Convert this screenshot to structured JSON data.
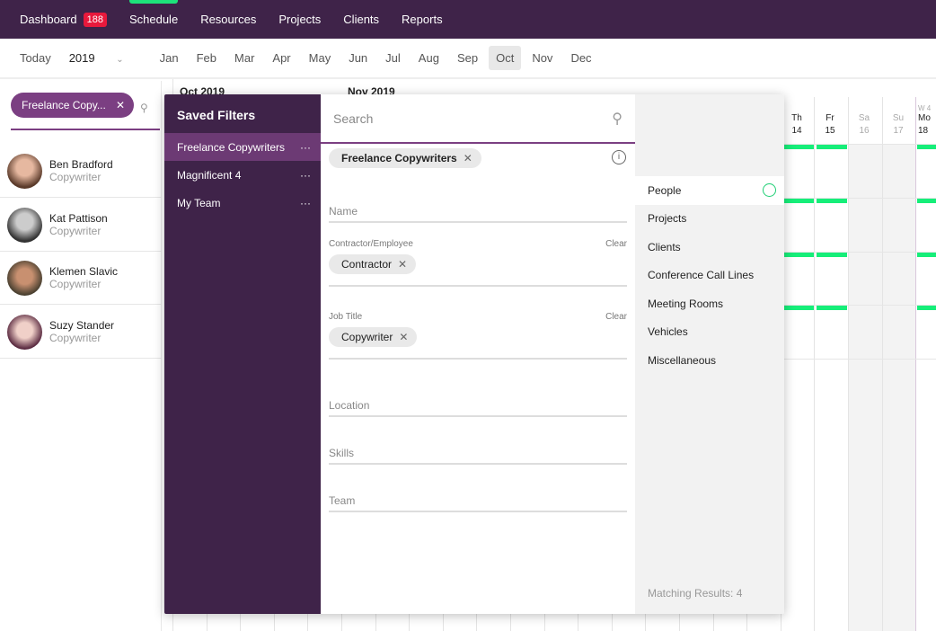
{
  "nav": {
    "items": [
      {
        "label": "Dashboard",
        "badge": "188"
      },
      {
        "label": "Schedule"
      },
      {
        "label": "Resources"
      },
      {
        "label": "Projects"
      },
      {
        "label": "Clients"
      },
      {
        "label": "Reports"
      }
    ],
    "active": "Schedule",
    "badge_color": "#e8193c",
    "accent": "#1de27a"
  },
  "months": {
    "today": "Today",
    "year": "2019",
    "list": [
      "Jan",
      "Feb",
      "Mar",
      "Apr",
      "May",
      "Jun",
      "Jul",
      "Aug",
      "Sep",
      "Oct",
      "Nov",
      "Dec"
    ],
    "selected": "Oct"
  },
  "left": {
    "filter_chip": "Freelance Copy...",
    "people": [
      {
        "name": "Ben Bradford",
        "role": "Copywriter"
      },
      {
        "name": "Kat Pattison",
        "role": "Copywriter"
      },
      {
        "name": "Klemen Slavic",
        "role": "Copywriter"
      },
      {
        "name": "Suzy Stander",
        "role": "Copywriter"
      }
    ]
  },
  "calendar": {
    "month1": "Oct 2019",
    "month2": "Nov 2019",
    "week": "W 4",
    "days": [
      {
        "d": "Th",
        "n": "14"
      },
      {
        "d": "Fr",
        "n": "15"
      },
      {
        "d": "Sa",
        "n": "16"
      },
      {
        "d": "Su",
        "n": "17"
      },
      {
        "d": "Mo",
        "n": "18"
      }
    ]
  },
  "saved": {
    "title": "Saved Filters",
    "items": [
      "Freelance Copywriters",
      "Magnificent 4",
      "My Team"
    ],
    "active": "Freelance Copywriters"
  },
  "filter": {
    "search_placeholder": "Search",
    "active_tag": "Freelance Copywriters",
    "name": "Name",
    "contractor_label": "Contractor/Employee",
    "contractor_tag": "Contractor",
    "clear": "Clear",
    "job_label": "Job Title",
    "job_tag": "Copywriter",
    "location": "Location",
    "skills": "Skills",
    "team": "Team"
  },
  "categories": {
    "items": [
      "People",
      "Projects",
      "Clients",
      "Conference Call Lines",
      "Meeting Rooms",
      "Vehicles",
      "Miscellaneous"
    ],
    "selected": "People",
    "matching": "Matching Results: 4"
  }
}
